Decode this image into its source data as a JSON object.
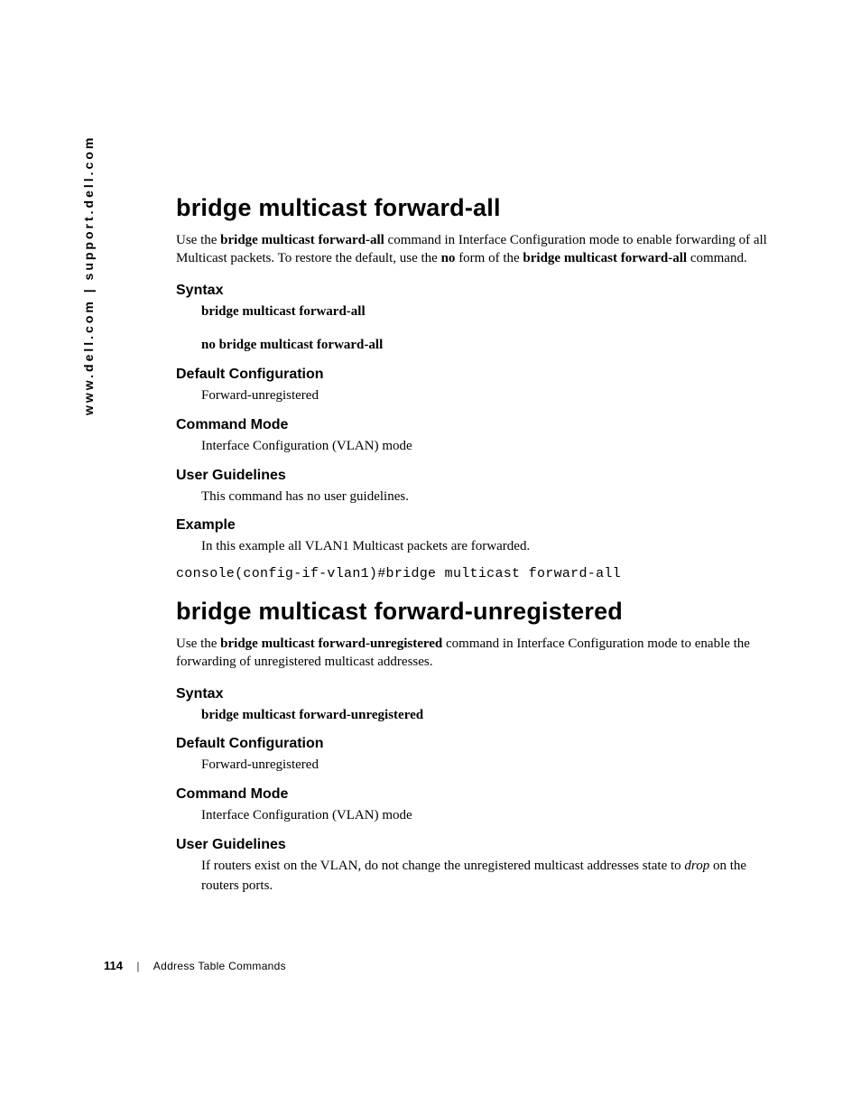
{
  "side_url": "www.dell.com | support.dell.com",
  "footer": {
    "page_number": "114",
    "chapter": "Address Table Commands"
  },
  "sections": [
    {
      "title": "bridge multicast forward-all",
      "intro_pre": "Use the ",
      "intro_bold1": "bridge multicast forward-all",
      "intro_mid1": " command in Interface Configuration mode to enable forwarding of all Multicast packets. To restore the default, use the ",
      "intro_bold2": "no",
      "intro_mid2": " form of the ",
      "intro_bold3": "bridge multicast forward-all",
      "intro_post": " command.",
      "syntax_heading": "Syntax",
      "syntax_lines": [
        "bridge multicast forward-all",
        "no bridge multicast forward-all"
      ],
      "default_heading": "Default Configuration",
      "default_text": "Forward-unregistered",
      "mode_heading": "Command Mode",
      "mode_text": "Interface Configuration (VLAN) mode",
      "guidelines_heading": "User Guidelines",
      "guidelines_text_plain": "This command has no user guidelines.",
      "example_heading": "Example",
      "example_text": "In this example all VLAN1 Multicast packets are forwarded.",
      "code": "console(config-if-vlan1)#bridge multicast forward-all"
    },
    {
      "title": "bridge multicast forward-unregistered",
      "intro_pre": "Use the ",
      "intro_bold1": "bridge multicast forward-unregistered",
      "intro_mid1": " command in Interface Configuration mode to enable the forwarding of unregistered multicast addresses.",
      "syntax_heading": "Syntax",
      "syntax_lines": [
        "bridge multicast forward-unregistered"
      ],
      "default_heading": "Default Configuration",
      "default_text": "Forward-unregistered",
      "mode_heading": "Command Mode",
      "mode_text": "Interface Configuration (VLAN) mode",
      "guidelines_heading": "User Guidelines",
      "guidelines_pre": "If routers exist on the VLAN, do not change the unregistered multicast addresses state to ",
      "guidelines_italic": "drop",
      "guidelines_post": " on the routers ports."
    }
  ]
}
